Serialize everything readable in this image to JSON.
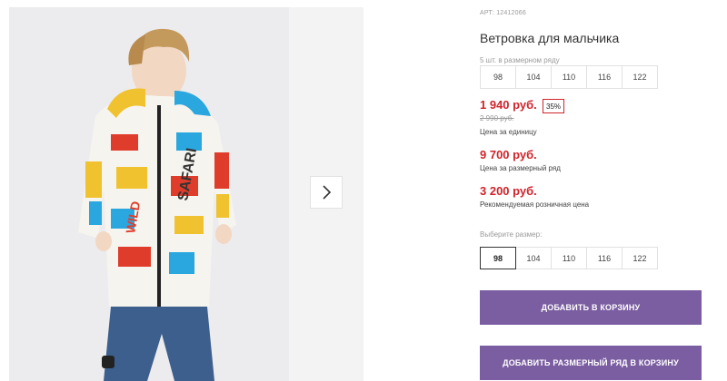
{
  "product": {
    "sku": "АРТ: 12412066",
    "title": "Ветровка для мальчика",
    "range_caption": "5 шт. в размерном ряду",
    "range_sizes": [
      "98",
      "104",
      "110",
      "116",
      "122"
    ],
    "price": "1 940 руб.",
    "discount": "35%",
    "old_price": "2 990 руб.",
    "price_caption": "Цена за единицу",
    "range_price": "9 700 руб.",
    "range_price_caption": "Цена за размерный ряд",
    "rrp": "3 200 руб.",
    "rrp_caption": "Рекомендуемая розничная цена",
    "choose_size_caption": "Выберите размер:",
    "select_sizes": [
      "98",
      "104",
      "110",
      "116",
      "122"
    ],
    "selected_size": "98",
    "add_to_cart_label": "ДОБАВИТЬ В КОРЗИНУ",
    "add_range_to_cart_label": "ДОБАВИТЬ РАЗМЕРНЫЙ РЯД В КОРЗИНУ"
  },
  "gallery": {
    "next_icon": "chevron-right-icon",
    "jacket_print": "SAFARI",
    "jacket_patch": "WILD"
  },
  "colors": {
    "price_red": "#d1232a",
    "button_purple": "#7b5ea1",
    "photo_background": "#ececee"
  }
}
